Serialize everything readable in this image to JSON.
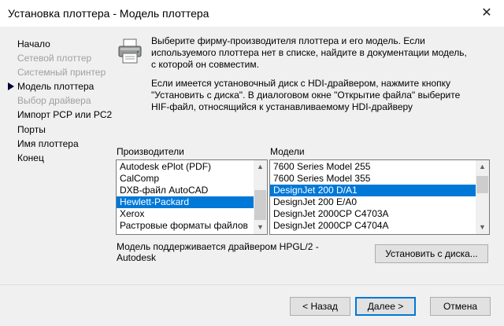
{
  "window": {
    "title": "Установка плоттера - Модель плоттера",
    "close_glyph": "✕"
  },
  "steps": [
    {
      "label": "Начало",
      "state": "enabled"
    },
    {
      "label": "Сетевой плоттер",
      "state": "disabled"
    },
    {
      "label": "Системный принтер",
      "state": "disabled"
    },
    {
      "label": "Модель плоттера",
      "state": "current"
    },
    {
      "label": "Выбор драйвера",
      "state": "disabled"
    },
    {
      "label": "Импорт PCP или PC2",
      "state": "enabled"
    },
    {
      "label": "Порты",
      "state": "enabled"
    },
    {
      "label": "Имя плоттера",
      "state": "enabled"
    },
    {
      "label": "Конец",
      "state": "enabled"
    }
  ],
  "description": {
    "paragraph1": [
      "Выберите фирму-производителя плоттера и его модель. Если",
      "используемого плоттера нет в списке, найдите в документации модель,",
      "с которой он совместим."
    ],
    "paragraph2": [
      "Если имеется установочный диск с HDI-драйвером, нажмите кнопку",
      "\"Установить с диска\". В диалоговом окне \"Открытие файла\" выберите",
      "HIF-файл, относящийся к устанавливаемому HDI-драйверу"
    ]
  },
  "manufacturers": {
    "label": "Производители",
    "items": [
      "Autodesk ePlot (PDF)",
      "CalComp",
      "DXB-файл AutoCAD",
      "Hewlett-Packard",
      "Xerox",
      "Растровые форматы файлов"
    ],
    "selected_index": 3
  },
  "models": {
    "label": "Модели",
    "items": [
      "7600 Series Model 255",
      "7600 Series Model 355",
      "DesignJet 200 D/A1",
      "DesignJet 200 E/A0",
      "DesignJet 2000CP C4703A",
      "DesignJet 2000CP C4704A"
    ],
    "selected_index": 2
  },
  "driver_info": [
    "Модель поддерживается драйвером HPGL/2 -",
    "Autodesk"
  ],
  "buttons": {
    "install": "Установить с диска...",
    "back": "< Назад",
    "next": "Далее >",
    "cancel": "Отмена"
  },
  "colors": {
    "accent": "#0078d7",
    "disabled_text": "#a0a0a0",
    "background": "#f0f0f0"
  },
  "icons": {
    "printer": "printer-icon",
    "current_step": "triangle-right-icon"
  }
}
